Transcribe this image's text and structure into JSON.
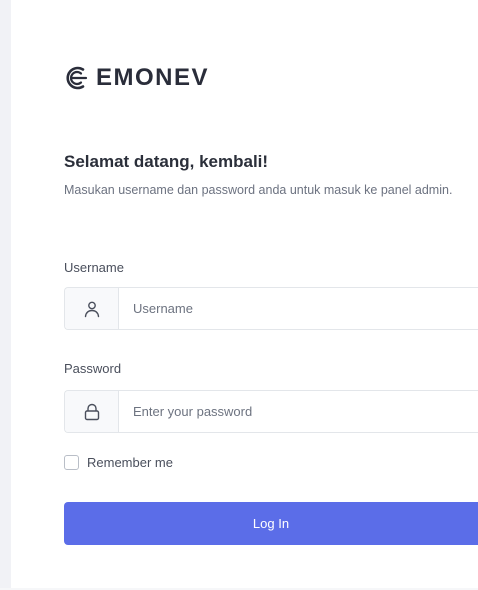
{
  "brand": {
    "name": "EMONEV",
    "logo_icon": "emonev-logo-icon"
  },
  "heading": {
    "title": "Selamat datang, kembali!",
    "subtitle": "Masukan username dan password anda untuk masuk ke panel admin."
  },
  "form": {
    "username": {
      "label": "Username",
      "placeholder": "Username",
      "value": "",
      "icon": "user-icon"
    },
    "password": {
      "label": "Password",
      "placeholder": "Enter your password",
      "value": "",
      "icon": "lock-icon"
    },
    "remember": {
      "label": "Remember me",
      "checked": false
    },
    "submit_label": "Log In"
  },
  "colors": {
    "primary": "#5b6de8",
    "heading": "#2b2f3a",
    "muted": "#6c7280",
    "border": "#e3e6ea"
  }
}
